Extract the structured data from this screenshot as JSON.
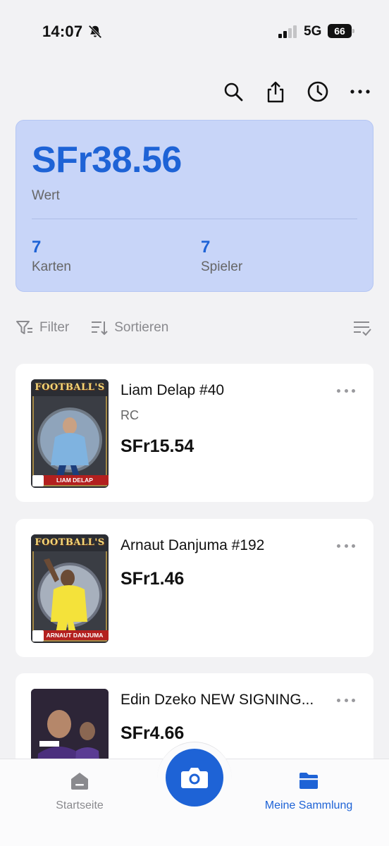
{
  "status": {
    "time": "14:07",
    "network": "5G",
    "battery": "66"
  },
  "summary": {
    "total_value": "SFr38.56",
    "total_label": "Wert",
    "cards_count": "7",
    "cards_label": "Karten",
    "players_count": "7",
    "players_label": "Spieler"
  },
  "toolbar": {
    "filter_label": "Filter",
    "sort_label": "Sortieren"
  },
  "cards": [
    {
      "title": "Liam Delap #40",
      "badge": "RC",
      "price": "SFr15.54",
      "banner": "FOOTBALL'S",
      "name_strip": "LIAM DELAP"
    },
    {
      "title": "Arnaut Danjuma #192",
      "price": "SFr1.46",
      "banner": "FOOTBALL'S",
      "name_strip": "ARNAUT DANJUMA"
    },
    {
      "title": "Edin Dzeko NEW SIGNING...",
      "price": "SFr4.66"
    }
  ],
  "nav": {
    "home_label": "Startseite",
    "collection_label": "Meine Sammlung"
  },
  "colors": {
    "accent": "#1e63d6",
    "summary_bg": "#c8d5f8",
    "background": "#f2f2f4"
  }
}
